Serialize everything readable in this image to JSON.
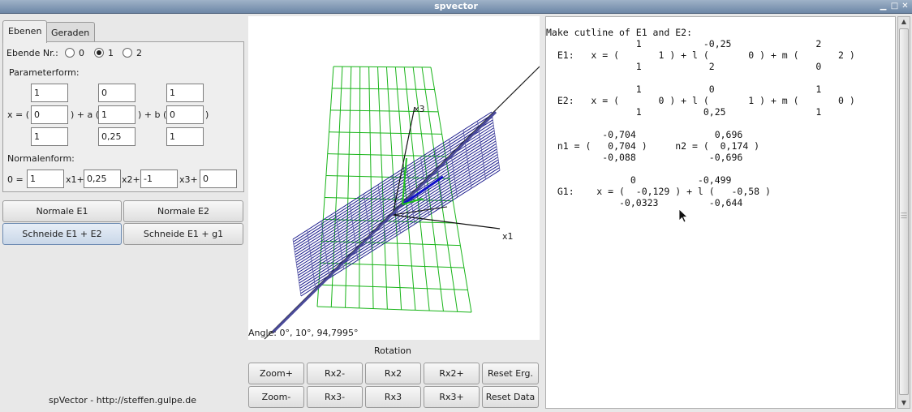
{
  "window": {
    "title": "spvector",
    "buttons": [
      "▁",
      "□",
      "✕"
    ]
  },
  "tabs": [
    {
      "label": "Ebenen"
    },
    {
      "label": "Geraden"
    }
  ],
  "ebene": {
    "label": "Ebende Nr.:",
    "options": [
      "0",
      "1",
      "2"
    ],
    "selected": "1"
  },
  "parameterform": {
    "label": "Parameterform:",
    "x_prefix": "x = (",
    "a_prefix": ") + a (",
    "b_prefix": ") + b (",
    "close": ")",
    "p": [
      "1",
      "0",
      "1"
    ],
    "a": [
      "0",
      "1",
      "0,25"
    ],
    "b": [
      "1",
      "0",
      "1"
    ]
  },
  "normalenform": {
    "label": "Normalenform:",
    "prefix": "0 =",
    "values": [
      "1",
      "0,25",
      "-1",
      "0"
    ],
    "suffixes": [
      "x1+",
      "x2+",
      "x3+"
    ]
  },
  "buttons_left": {
    "normale_e1": "Normale E1",
    "normale_e2": "Normale E2",
    "schneide_e1_e2": "Schneide E1 + E2",
    "schneide_e1_g1": "Schneide E1 + g1"
  },
  "footer": "spVector - http://steffen.gulpe.de",
  "canvas": {
    "angle_text": "Angle: 0°, 10°, 94,7995°",
    "axis_x1": "x1",
    "axis_x3": "x3"
  },
  "rotation": {
    "label": "Rotation",
    "row1": [
      "Zoom+",
      "Rx2-",
      "Rx2",
      "Rx2+",
      "Reset Erg."
    ],
    "row2": [
      "Zoom-",
      "Rx3-",
      "Rx3",
      "Rx3+",
      "Reset Data"
    ]
  },
  "output_text": "Make cutline of E1 and E2:\n                1           -0,25               2\n  E1:   x = (       1 ) + l (       0 ) + m (       2 )\n                1            2                  0\n\n                1            0                  1\n  E2:   x = (       0 ) + l (       1 ) + m (       0 )\n                1           0,25                1\n\n          -0,704              0,696\n  n1 = (   0,704 )     n2 = (  0,174 )\n          -0,088             -0,696\n\n               0           -0,499\n  G1:    x = (  -0,129 ) + l (   -0,58 )\n             -0,0323         -0,644",
  "colors": {
    "grid_green": "#18b418",
    "plane_blue": "#1a1a8c",
    "line_blue": "#1010c8",
    "titlebar": "#7f97b4"
  }
}
